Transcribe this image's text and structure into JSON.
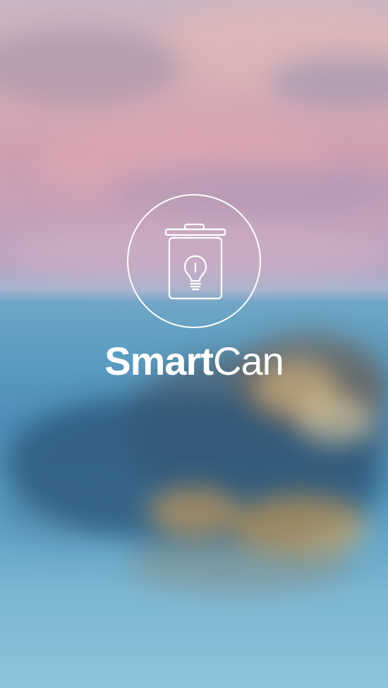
{
  "splash": {
    "app_name_bold": "Smart",
    "app_name_light": "Can",
    "logo_icon": "trash-can-lightbulb-icon",
    "logo_color": "#ffffff"
  },
  "background": {
    "image": "blurred-coastal-town-sunset-photo",
    "sky_top_color": "#d8aeb7",
    "water_color": "#5b9cc0"
  }
}
